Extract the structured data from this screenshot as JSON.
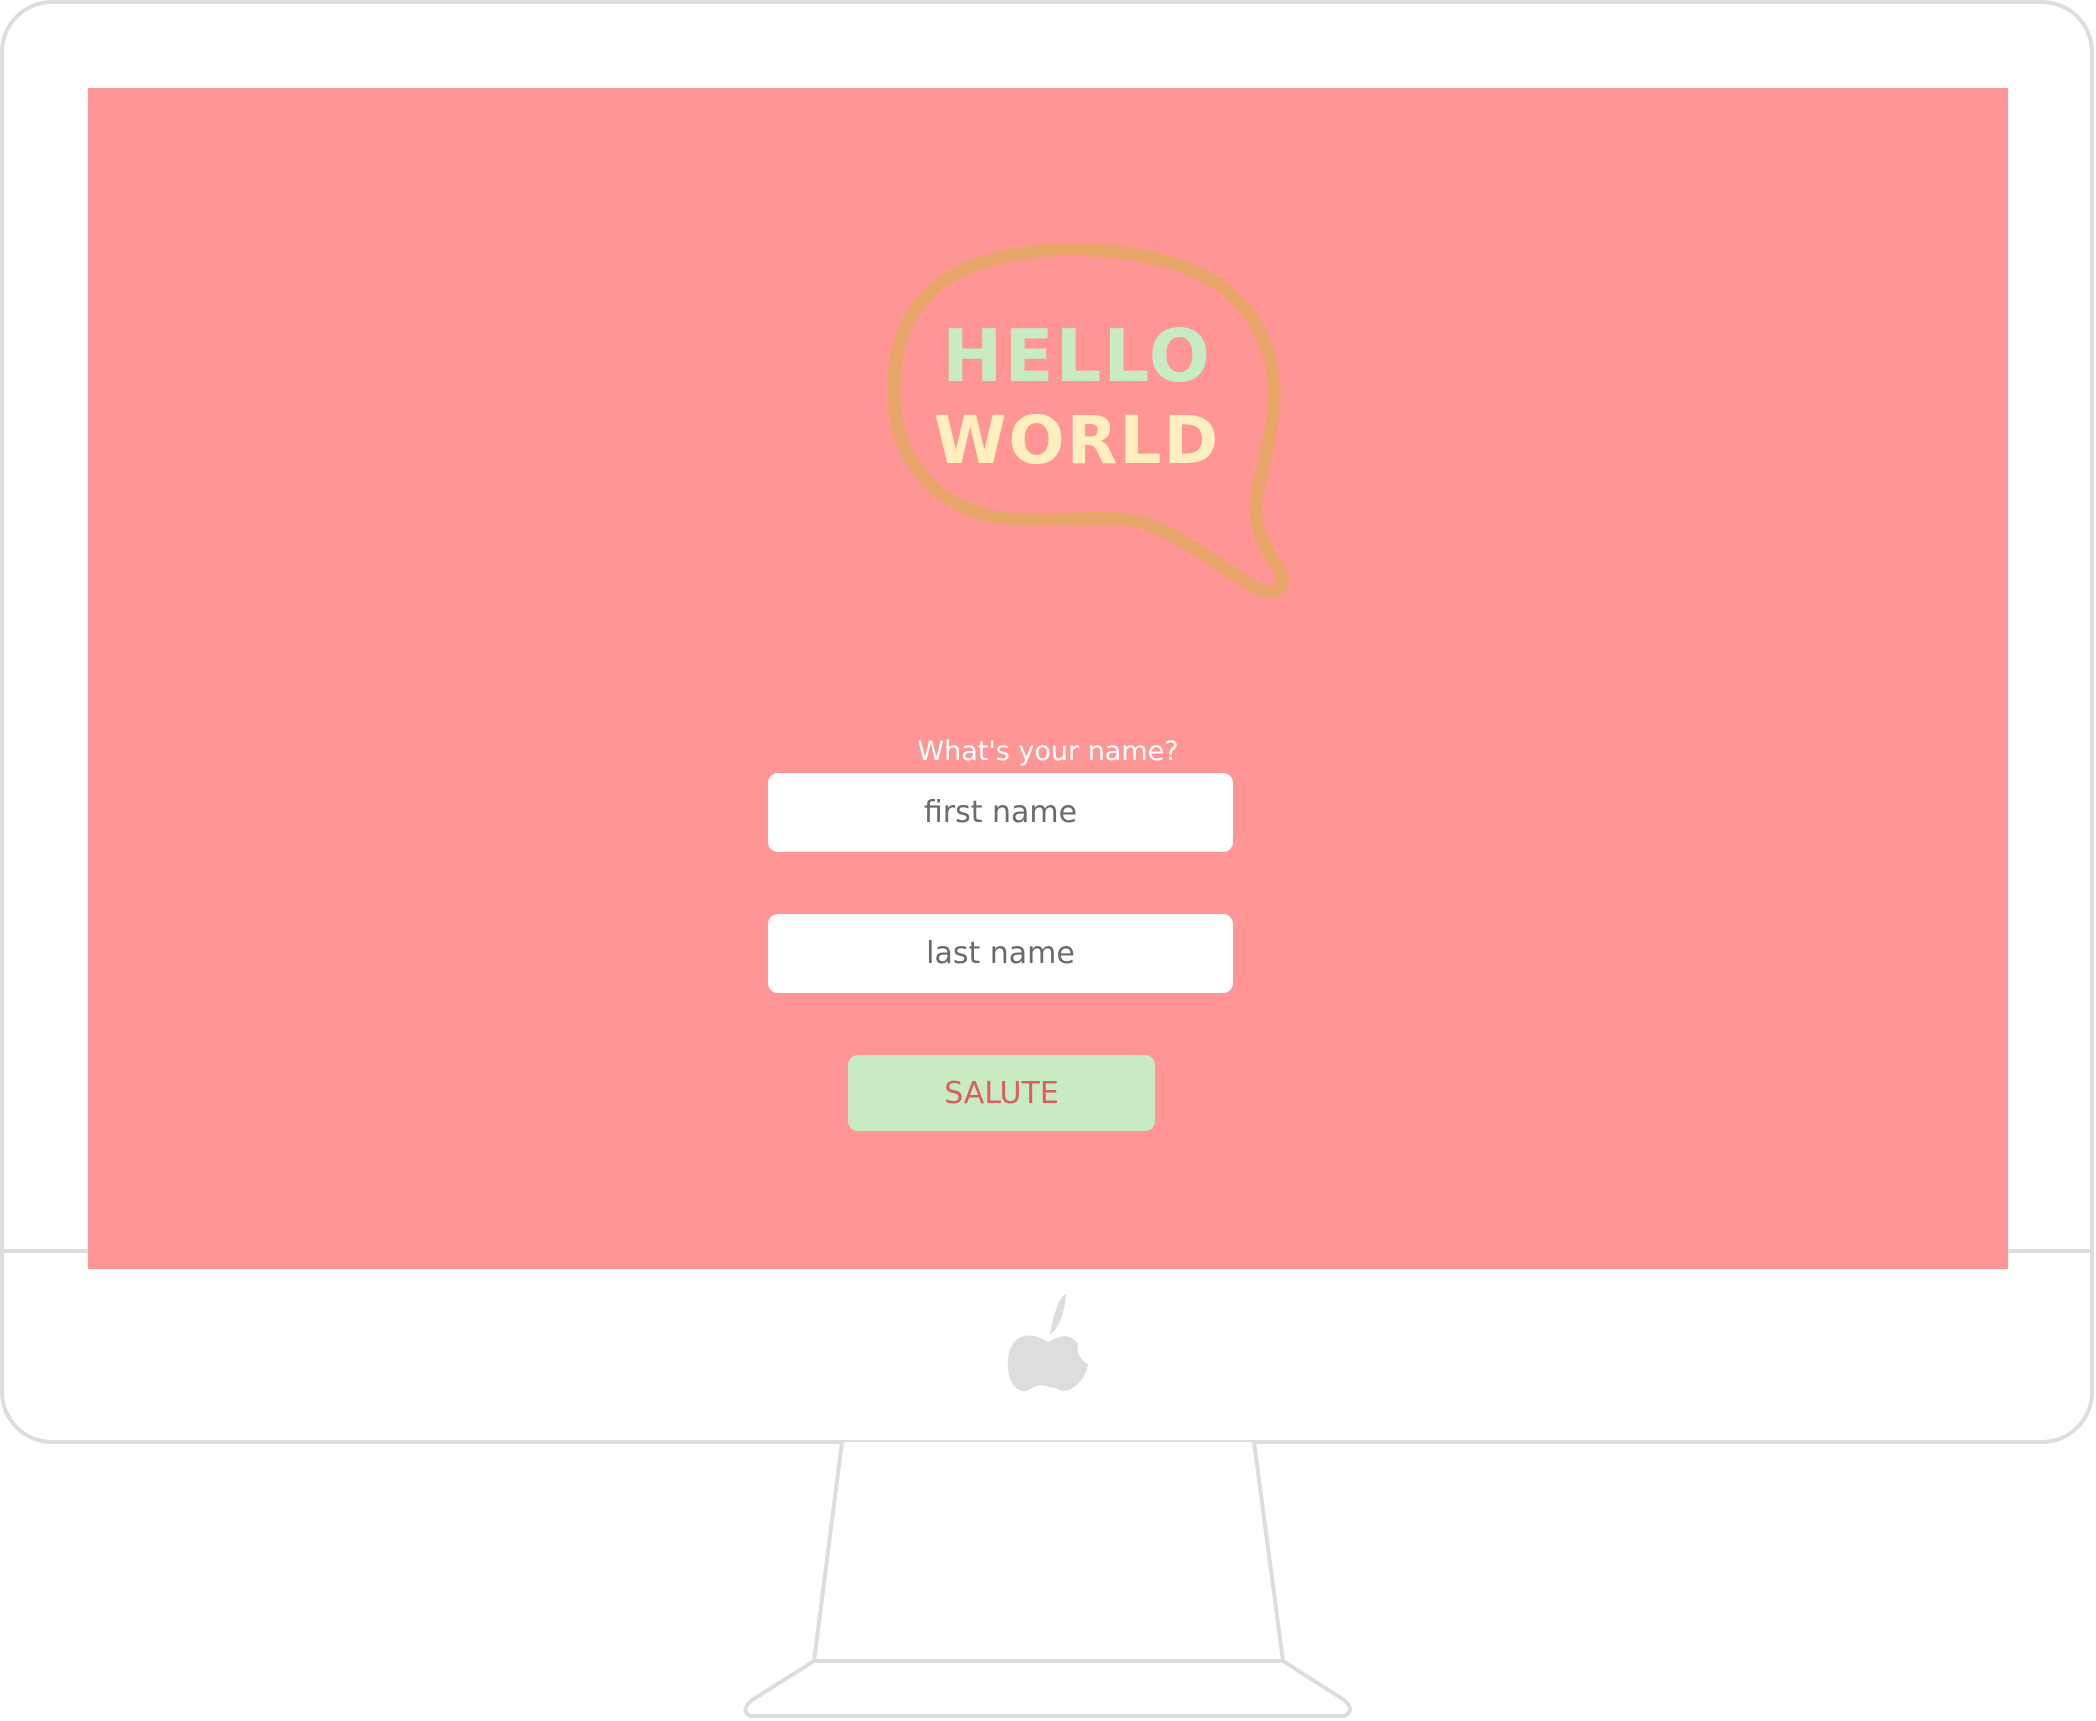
{
  "screen": {
    "background": "#ff9595",
    "logo": {
      "line1": "HELLO",
      "line2": "WORLD",
      "line1_color": "#c8ebc3",
      "line2_color": "#ffefbe",
      "outline_color": "#e8a56a"
    },
    "prompt": "What's your name?",
    "form": {
      "first_name_placeholder": "first name",
      "last_name_placeholder": "last name",
      "submit_label": "SALUTE"
    }
  },
  "monitor": {
    "brand_icon": "apple-logo-icon",
    "frame_color": "#dddddd"
  }
}
